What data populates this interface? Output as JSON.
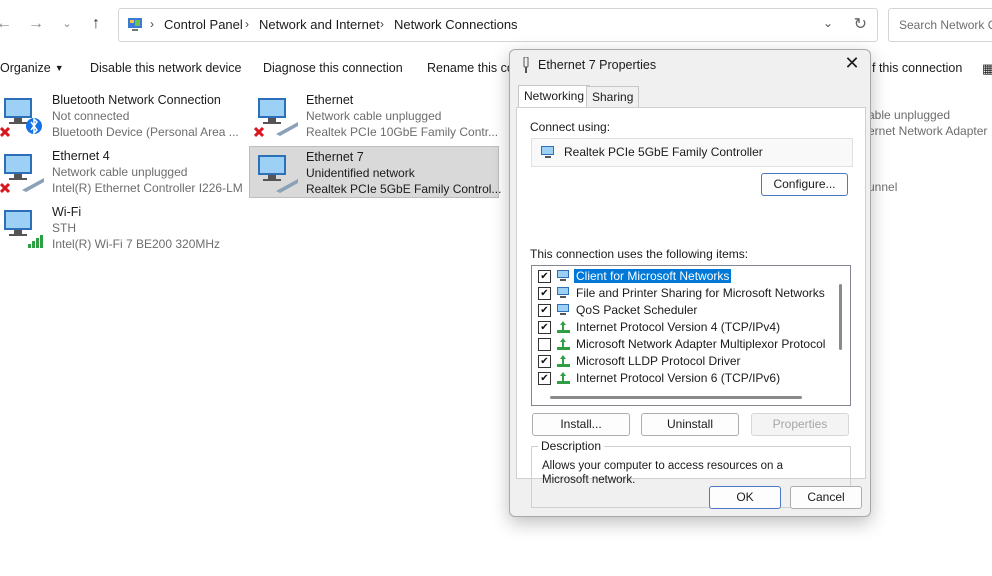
{
  "address_bar": {
    "crumbs": [
      "Control Panel",
      "Network and Internet",
      "Network Connections"
    ],
    "search_placeholder": "Search Network C"
  },
  "commands": {
    "organize": "Organize",
    "disable": "Disable this network device",
    "diagnose": "Diagnose this connection",
    "rename": "Rename this co",
    "partial_right": "f this connection"
  },
  "connections": [
    {
      "name": "Bluetooth Network Connection",
      "status": "Not connected",
      "device": "Bluetooth Device (Personal Area ..."
    },
    {
      "name": "Ethernet",
      "status": "Network cable unplugged",
      "device": "Realtek PCIe 10GbE Family Contr..."
    },
    {
      "name": "Ethernet 4",
      "status": "Network cable unplugged",
      "device": "Intel(R) Ethernet Controller I226-LM"
    },
    {
      "name": "Ethernet 7",
      "status": "Unidentified network",
      "device": "Realtek PCIe 5GbE Family Control..."
    },
    {
      "name": "Wi-Fi",
      "status": "STH",
      "device": "Intel(R) Wi-Fi 7 BE200 320MHz"
    }
  ],
  "partial_right": {
    "line1": "able unplugged",
    "line2": "ernet Network Adapter",
    "line3": "unnel"
  },
  "dialog": {
    "title": "Ethernet 7 Properties",
    "tabs": [
      "Networking",
      "Sharing"
    ],
    "connect_using_label": "Connect using:",
    "adapter": "Realtek PCIe 5GbE Family Controller",
    "configure": "Configure...",
    "items_label": "This connection uses the following items:",
    "items": [
      {
        "label": "Client for Microsoft Networks",
        "checked": true,
        "selected": true
      },
      {
        "label": "File and Printer Sharing for Microsoft Networks",
        "checked": true,
        "selected": false
      },
      {
        "label": "QoS Packet Scheduler",
        "checked": true,
        "selected": false
      },
      {
        "label": "Internet Protocol Version 4 (TCP/IPv4)",
        "checked": true,
        "selected": false
      },
      {
        "label": "Microsoft Network Adapter Multiplexor Protocol",
        "checked": false,
        "selected": false
      },
      {
        "label": "Microsoft LLDP Protocol Driver",
        "checked": true,
        "selected": false
      },
      {
        "label": "Internet Protocol Version 6 (TCP/IPv6)",
        "checked": true,
        "selected": false
      }
    ],
    "install": "Install...",
    "uninstall": "Uninstall",
    "properties": "Properties",
    "description_label": "Description",
    "description": "Allows your computer to access resources on a Microsoft network.",
    "ok": "OK",
    "cancel": "Cancel"
  }
}
